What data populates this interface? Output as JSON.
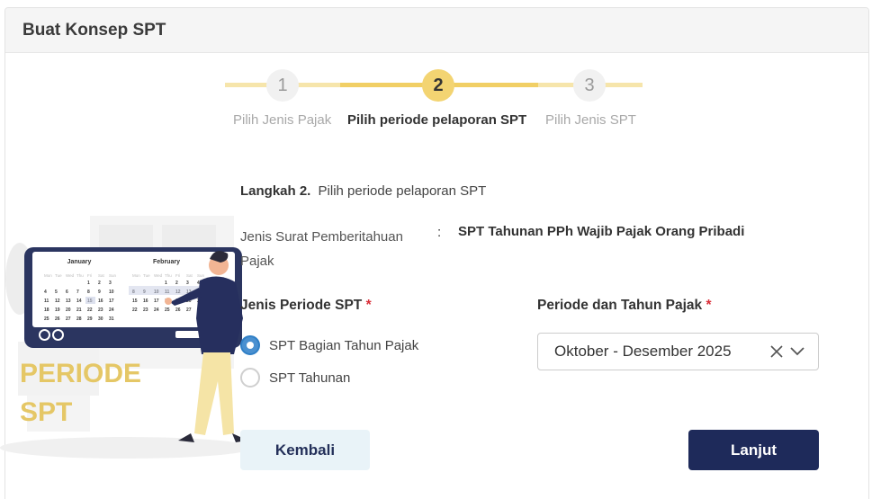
{
  "header": {
    "title": "Buat Konsep SPT"
  },
  "stepper": {
    "steps": [
      {
        "number": "1",
        "label": "Pilih Jenis Pajak",
        "state": "done"
      },
      {
        "number": "2",
        "label": "Pilih periode pelaporan SPT",
        "state": "active"
      },
      {
        "number": "3",
        "label": "Pilih Jenis SPT",
        "state": "pending"
      }
    ]
  },
  "illustration": {
    "months": [
      "January",
      "February"
    ],
    "weekdays": [
      "Mon",
      "Tue",
      "Wed",
      "Thu",
      "Fri",
      "Sat",
      "Sun"
    ],
    "caption_line1": "PERIODE",
    "caption_line2": "SPT"
  },
  "form": {
    "step_prefix": "Langkah 2.",
    "step_text": "Pilih periode pelaporan SPT",
    "jenis_label": "Jenis Surat Pemberitahuan Pajak",
    "colon": ":",
    "jenis_value": "SPT Tahunan PPh Wajib Pajak Orang Pribadi",
    "periode_title": "Jenis Periode SPT",
    "required_mark": "*",
    "periode_options": [
      {
        "label": "SPT Bagian Tahun Pajak",
        "checked": true
      },
      {
        "label": "SPT Tahunan",
        "checked": false
      }
    ],
    "tahun_title": "Periode dan Tahun Pajak",
    "tahun_value": "Oktober - Desember 2025"
  },
  "buttons": {
    "back": "Kembali",
    "next": "Lanjut"
  },
  "colors": {
    "accent": "#f3d472",
    "primary": "#1e2a5a",
    "radio": "#4a90d0"
  }
}
